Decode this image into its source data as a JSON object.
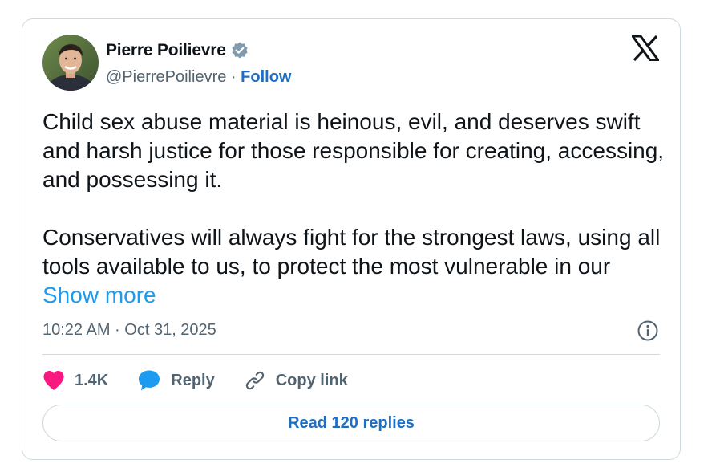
{
  "author": {
    "name": "Pierre Poilievre",
    "handle": "@PierrePoilievre",
    "separator": " · ",
    "follow_label": "Follow",
    "verified": true
  },
  "brand_icon": "x-logo-icon",
  "tweet": {
    "text": "Child sex abuse material is heinous, evil, and deserves swift and harsh justice for those responsible for creating, accessing, and possessing it.\n\nConservatives will always fight for the strongest laws, using all tools available to us, to protect the most vulnerable in our ",
    "show_more_label": "Show more"
  },
  "meta": {
    "timestamp": "10:22 AM · Oct 31, 2025"
  },
  "actions": {
    "like_count": "1.4K",
    "reply_label": "Reply",
    "copy_link_label": "Copy link"
  },
  "read_replies_label": "Read 120 replies",
  "colors": {
    "like": "#f91880",
    "reply": "#1d9bf0",
    "link": "#1d6fc6",
    "muted": "#536471",
    "border": "#cfd9de"
  }
}
